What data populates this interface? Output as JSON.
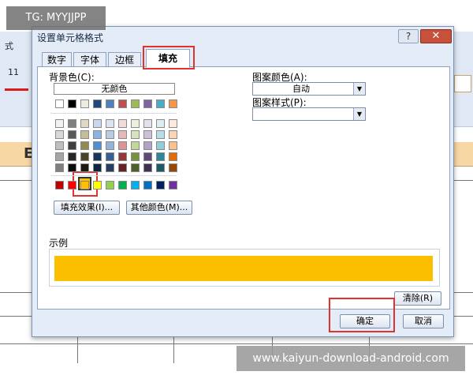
{
  "overlay": {
    "tg": "TG: MYYJJPP",
    "watermark": "www.kaiyun-download-android.com"
  },
  "sheet": {
    "ribbon_text_1": "式",
    "ribbon_text_2": "11",
    "column_letter": "E"
  },
  "dialog": {
    "title": "设置单元格格式",
    "help_label": "?",
    "close_label": "✕",
    "tabs": [
      "数字",
      "字体",
      "边框",
      "填充"
    ],
    "active_tab": "填充",
    "background_color_label": "背景色(C):",
    "no_color_label": "无颜色",
    "fill_effects_button": "填充效果(I)...",
    "more_colors_button": "其他颜色(M)...",
    "pattern_color_label": "图案颜色(A):",
    "pattern_color_value": "自动",
    "pattern_style_label": "图案样式(P):",
    "pattern_style_value": "",
    "sample_label": "示例",
    "sample_color": "#fbbf00",
    "clear_button": "清除(R)",
    "ok_button": "确定",
    "cancel_button": "取消"
  },
  "palette": {
    "theme_row": [
      "#ffffff",
      "#000000",
      "#eeece1",
      "#1f497d",
      "#4f81bd",
      "#c0504d",
      "#9bbb59",
      "#8064a2",
      "#4bacc6",
      "#f79646"
    ],
    "tint_rows": [
      [
        "#f2f2f2",
        "#7f7f7f",
        "#ddd9c3",
        "#c6d9f0",
        "#dbe5f1",
        "#f2dcdb",
        "#ebf1dd",
        "#e5e0ec",
        "#dbeef3",
        "#fdeada"
      ],
      [
        "#d8d8d8",
        "#595959",
        "#c4bd97",
        "#8db3e2",
        "#b8cce4",
        "#e5b9b7",
        "#d7e3bc",
        "#ccc1d9",
        "#b7dde8",
        "#fbd5b5"
      ],
      [
        "#bfbfbf",
        "#3f3f3f",
        "#938953",
        "#548dd4",
        "#95b3d7",
        "#d99694",
        "#c3d69b",
        "#b2a2c7",
        "#92cddc",
        "#fac08f"
      ],
      [
        "#a5a5a5",
        "#262626",
        "#494429",
        "#17365d",
        "#366092",
        "#953734",
        "#76923c",
        "#5f497a",
        "#31859b",
        "#e36c09"
      ],
      [
        "#7f7f7f",
        "#0c0c0c",
        "#1d1b10",
        "#0f243e",
        "#244061",
        "#632423",
        "#4f6128",
        "#3f3151",
        "#205867",
        "#974806"
      ]
    ],
    "standard_row": [
      "#c00000",
      "#ff0000",
      "#ffc000",
      "#ffff00",
      "#92d050",
      "#00b050",
      "#00b0f0",
      "#0070c0",
      "#002060",
      "#7030a0"
    ],
    "selected": "#ffc000"
  }
}
